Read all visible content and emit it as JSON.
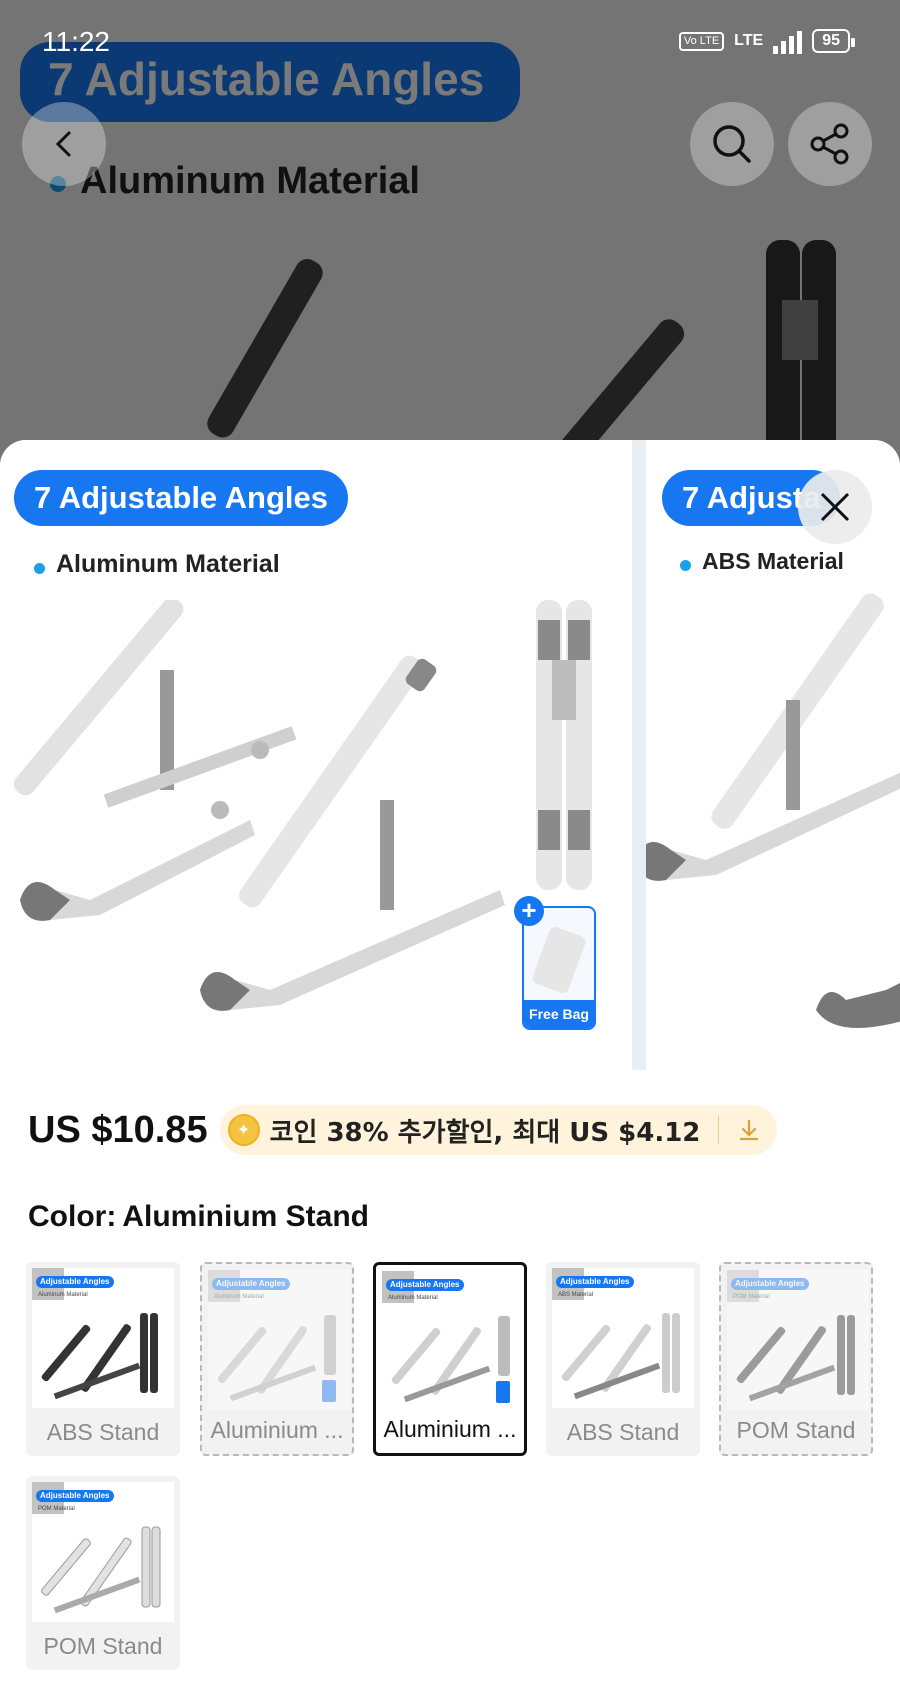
{
  "status_bar": {
    "time": "11:22",
    "volte": "Vo LTE",
    "network": "LTE",
    "battery": "95"
  },
  "background": {
    "banner_title": "7 Adjustable Angles",
    "material": "Aluminum Material"
  },
  "carousel": {
    "slides": [
      {
        "title": "7 Adjustable Angles",
        "material": "Aluminum Material",
        "bag_label": "Free Bag"
      },
      {
        "title": "7 Adjusta",
        "material": "ABS Material"
      }
    ]
  },
  "price": {
    "amount": "US $10.85",
    "coin_text": "코인 38% 추가할인, 최대 US $4.12"
  },
  "color": {
    "label": "Color:",
    "selected": "Aluminium Stand",
    "options": [
      {
        "label": "ABS Stand",
        "thumb_title": "Adjustable Angles",
        "thumb_material": "Aluminum Material"
      },
      {
        "label": "Aluminium ...",
        "thumb_title": "Adjustable Angles",
        "thumb_material": "Aluminum Material"
      },
      {
        "label": "Aluminium ...",
        "thumb_title": "Adjustable Angles",
        "thumb_material": "Aluminum Material"
      },
      {
        "label": "ABS Stand",
        "thumb_title": "Adjustable Angles",
        "thumb_material": "ABS Material"
      },
      {
        "label": "POM Stand",
        "thumb_title": "Adjustable Angles",
        "thumb_material": "POM Material"
      },
      {
        "label": "POM Stand",
        "thumb_title": "Adjustable Angles",
        "thumb_material": "POM Material"
      }
    ]
  },
  "colors": {
    "accent": "#1777f0",
    "coin_bg": "#fff3dc",
    "coin": "#f5c342"
  },
  "icons": {
    "back": "back-arrow-icon",
    "search": "search-icon",
    "share": "share-icon",
    "close": "close-icon",
    "download": "download-icon"
  }
}
